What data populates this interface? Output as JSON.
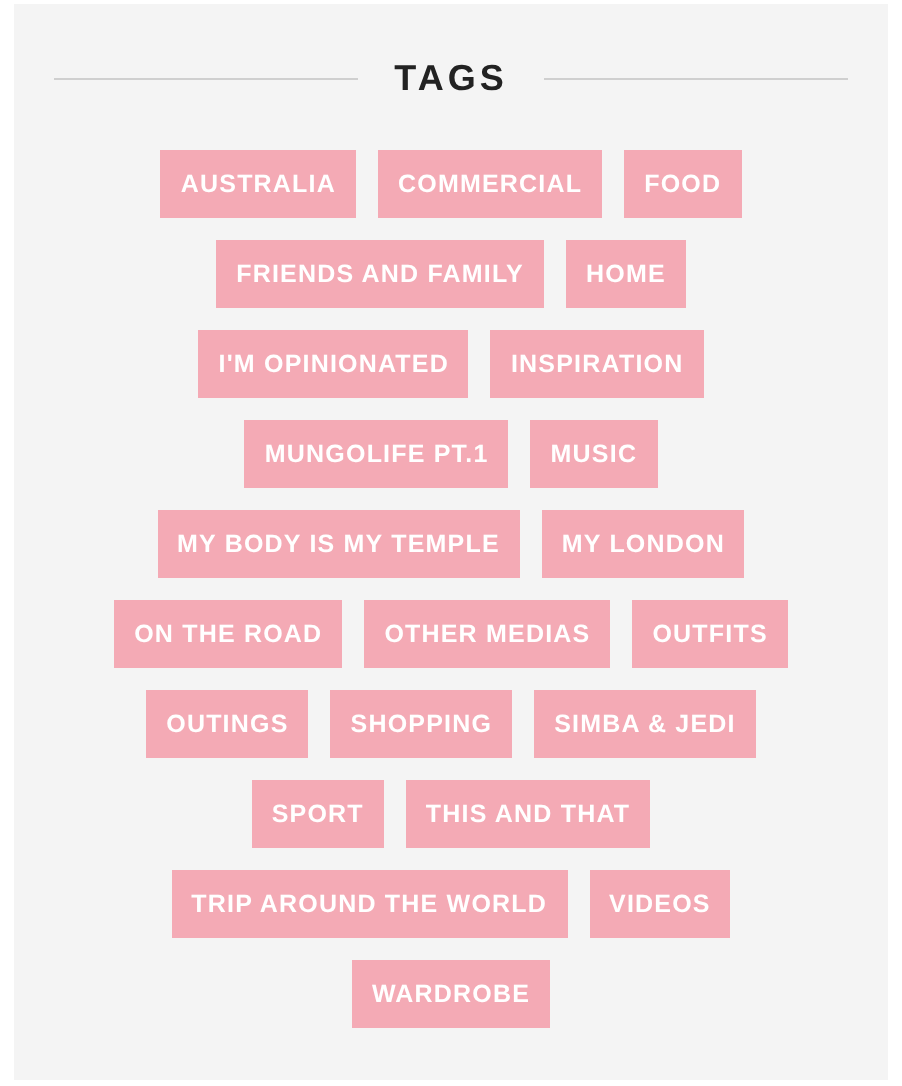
{
  "heading": "TAGS",
  "tags": [
    "AUSTRALIA",
    "COMMERCIAL",
    "FOOD",
    "FRIENDS AND FAMILY",
    "HOME",
    "I'M OPINIONATED",
    "INSPIRATION",
    "MUNGOLIFE PT.1",
    "MUSIC",
    "MY BODY IS MY TEMPLE",
    "MY LONDON",
    "ON THE ROAD",
    "OTHER MEDIAS",
    "OUTFITS",
    "OUTINGS",
    "SHOPPING",
    "SIMBA & JEDI",
    "SPORT",
    "THIS AND THAT",
    "TRIP AROUND THE WORLD",
    "VIDEOS",
    "WARDROBE"
  ]
}
